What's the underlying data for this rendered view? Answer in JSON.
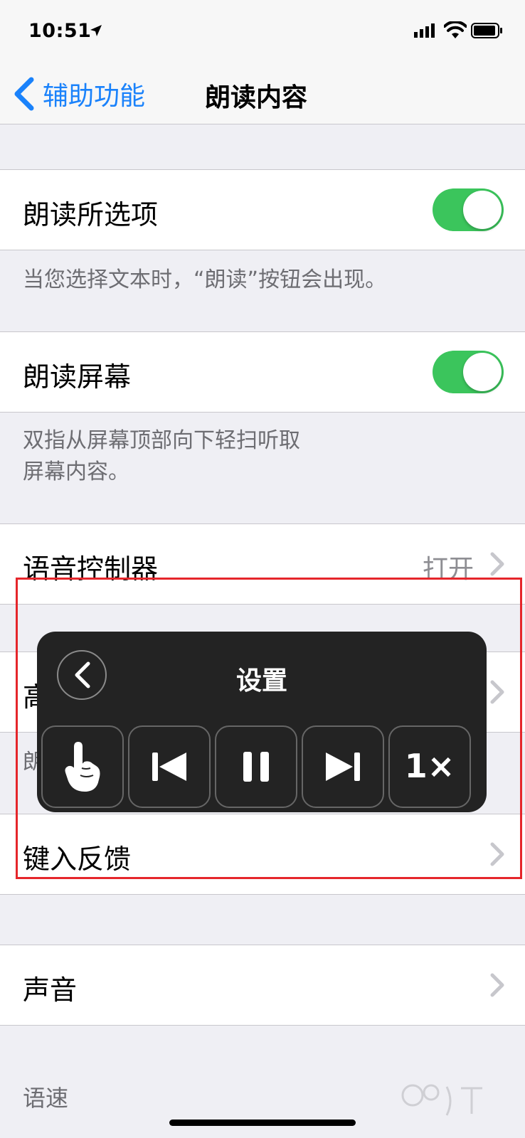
{
  "status_bar": {
    "time": "10:51"
  },
  "nav": {
    "back_label": "辅助功能",
    "title": "朗读内容"
  },
  "sections": {
    "speak_selection": {
      "label": "朗读所选项",
      "enabled": true,
      "footer": "当您选择文本时，“朗读”按钮会出现。"
    },
    "speak_screen": {
      "label": "朗读屏幕",
      "enabled": true,
      "footer_line1": "双指从屏幕顶部向下轻扫听取",
      "footer_line2": "屏幕内容。"
    },
    "speech_controller": {
      "label": "语音控制器",
      "value": "打开"
    },
    "highlight_content": {
      "label_partial": "高",
      "footer_partial": "朗"
    },
    "typing_feedback": {
      "label": "键入反馈"
    },
    "voices": {
      "label": "声音"
    },
    "speaking_rate": {
      "label": "语速"
    }
  },
  "speech_panel": {
    "title": "设置",
    "buttons": [
      "pointer-hand",
      "skip-back",
      "pause",
      "skip-forward"
    ],
    "speed_label": "1×"
  },
  "colors": {
    "accent": "#1a82fb",
    "toggle_on": "#3bc55c",
    "panel_bg": "#232323",
    "annotation_box": "#e5262b"
  }
}
